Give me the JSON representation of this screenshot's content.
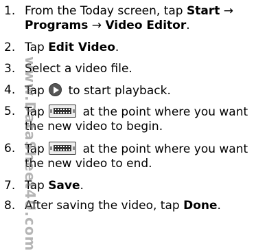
{
  "steps": [
    {
      "number": "1.",
      "lines": [
        {
          "parts": [
            {
              "text": "From the Today screen, tap "
            },
            {
              "text": "Start",
              "bold": true
            },
            {
              "text": " →"
            }
          ]
        },
        {
          "parts": [
            {
              "text": "Programs",
              "bold": true
            },
            {
              "text": " → "
            },
            {
              "text": "Video Editor",
              "bold": true
            },
            {
              "text": "."
            }
          ]
        }
      ]
    },
    {
      "number": "2.",
      "lines": [
        {
          "parts": [
            {
              "text": "Tap "
            },
            {
              "text": "Edit Video",
              "bold": true
            },
            {
              "text": "."
            }
          ]
        }
      ]
    },
    {
      "number": "3.",
      "lines": [
        {
          "parts": [
            {
              "text": "Select a video file."
            }
          ]
        }
      ]
    },
    {
      "number": "4.",
      "lines": [
        {
          "parts": [
            {
              "text": "Tap "
            },
            {
              "icon": "play-icon"
            },
            {
              "text": " to start playback."
            }
          ]
        }
      ]
    },
    {
      "number": "5.",
      "lines": [
        {
          "parts": [
            {
              "text": "Tap "
            },
            {
              "icon": "film-start-icon"
            },
            {
              "text": " at the point where you want"
            }
          ]
        },
        {
          "parts": [
            {
              "text": "the new video to begin."
            }
          ]
        }
      ]
    },
    {
      "number": "6.",
      "lines": [
        {
          "parts": [
            {
              "text": "Tap "
            },
            {
              "icon": "film-end-icon"
            },
            {
              "text": " at the point where you want"
            }
          ]
        },
        {
          "parts": [
            {
              "text": "the new video to end."
            }
          ]
        }
      ]
    },
    {
      "number": "7.",
      "lines": [
        {
          "parts": [
            {
              "text": "Tap "
            },
            {
              "text": "Save",
              "bold": true
            },
            {
              "text": "."
            }
          ]
        }
      ]
    },
    {
      "number": "8.",
      "lines": [
        {
          "parts": [
            {
              "text": "After saving the video, tap "
            },
            {
              "text": "Done",
              "bold": true
            },
            {
              "text": "."
            }
          ]
        }
      ]
    }
  ],
  "watermark": "www.DataSheet4U.com"
}
